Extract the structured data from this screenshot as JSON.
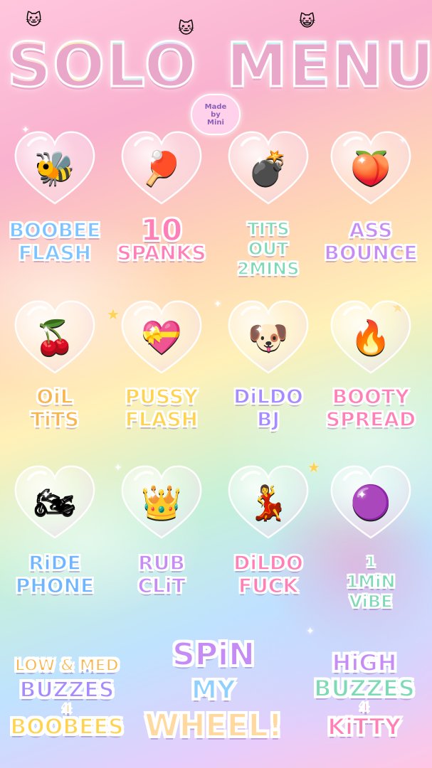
{
  "title": {
    "word1": "SOLO",
    "word2": "MENU"
  },
  "badge": {
    "line1": "Made",
    "line2": "by",
    "line3": "Mini"
  },
  "items": [
    {
      "icon": "bee-icon",
      "glyph": "🐝",
      "line1": "BOOBEE",
      "line2": "FLASH",
      "line3": ""
    },
    {
      "icon": "paddle-icon",
      "glyph": "🏓",
      "line1": "10",
      "line2": "SPANKS",
      "line3": ""
    },
    {
      "icon": "bomb-icon",
      "glyph": "💣",
      "line1": "TITS",
      "line2": "OUT",
      "line3": "2MINS"
    },
    {
      "icon": "peach-icon",
      "glyph": "🍑",
      "line1": "ASS",
      "line2": "BOUNCE",
      "line3": ""
    },
    {
      "icon": "cherries-icon",
      "glyph": "🍒",
      "line1": "OiL",
      "line2": "TiTS",
      "line3": ""
    },
    {
      "icon": "heart-panties-icon",
      "glyph": "💝",
      "line1": "PUSSY",
      "line2": "FLASH",
      "line3": ""
    },
    {
      "icon": "puppy-icon",
      "glyph": "🐶",
      "line1": "DiLDO",
      "line2": "BJ",
      "line3": ""
    },
    {
      "icon": "flame-icon",
      "glyph": "🔥",
      "line1": "BOOTY",
      "line2": "SPREAD",
      "line3": ""
    },
    {
      "icon": "motorcycle-icon",
      "glyph": "🏍",
      "line1": "RiDE",
      "line2": "PHONE",
      "line3": ""
    },
    {
      "icon": "tiara-icon",
      "glyph": "👑",
      "line1": "RUB",
      "line2": "CLiT",
      "line3": ""
    },
    {
      "icon": "ballerina-icon",
      "glyph": "💃",
      "line1": "DiLDO",
      "line2": "FUCK",
      "line3": ""
    },
    {
      "icon": "vibe-icon",
      "glyph": "🟣",
      "line1": "1",
      "line2": "1MiN",
      "line3": "ViBE"
    }
  ],
  "bottom": {
    "left": {
      "line1": "LOW & MED",
      "line2": "BUZZES",
      "line3": "4",
      "line4": "BOOBEES"
    },
    "center": {
      "line1": "SPiN",
      "line2": "MY",
      "line3": "WHEEL!"
    },
    "right": {
      "line1": "HiGH",
      "line2": "BUZZES",
      "line3": "4",
      "line4": "KiTTY"
    }
  }
}
